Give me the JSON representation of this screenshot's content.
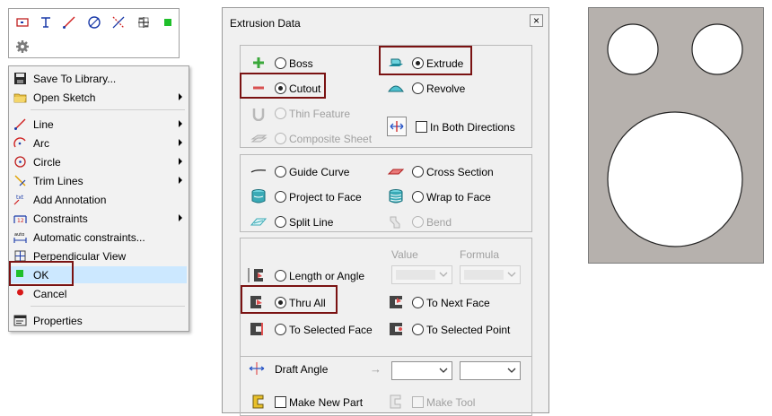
{
  "toolbar": {
    "buttons": [
      "rectangle-icon",
      "text-icon",
      "line-icon",
      "circle-icon",
      "trim-icon",
      "grid-icon",
      "ok-green-icon",
      "gear-icon"
    ]
  },
  "context_menu": {
    "items": [
      {
        "label": "Save To Library...",
        "icon": "save-icon",
        "submenu": false
      },
      {
        "label": "Open Sketch",
        "icon": "folder-icon",
        "submenu": true
      },
      {
        "label": "Line",
        "icon": "line-icon",
        "submenu": true
      },
      {
        "label": "Arc",
        "icon": "arc-icon",
        "submenu": true
      },
      {
        "label": "Circle",
        "icon": "circle-icon",
        "submenu": true
      },
      {
        "label": "Trim Lines",
        "icon": "trim-icon",
        "submenu": true
      },
      {
        "label": "Add Annotation",
        "icon": "annotation-icon",
        "submenu": false
      },
      {
        "label": "Constraints",
        "icon": "constraints-icon",
        "submenu": true
      },
      {
        "label": "Automatic constraints...",
        "icon": "auto-constraints-icon",
        "submenu": false
      },
      {
        "label": "Perpendicular View",
        "icon": "perpendicular-icon",
        "submenu": false
      },
      {
        "label": "OK",
        "icon": "ok-icon",
        "submenu": false
      },
      {
        "label": "Cancel",
        "icon": "cancel-icon",
        "submenu": false
      },
      {
        "label": "Properties",
        "icon": "properties-icon",
        "submenu": false
      }
    ],
    "highlighted": "OK"
  },
  "dialog": {
    "title": "Extrusion Data",
    "close_glyph": "×",
    "type_section": {
      "boss": {
        "label": "Boss",
        "selected": false
      },
      "cutout": {
        "label": "Cutout",
        "selected": true
      },
      "thin_feature": {
        "label": "Thin Feature",
        "enabled": false
      },
      "composite_sheet": {
        "label": "Composite Sheet",
        "enabled": false
      },
      "extrude": {
        "label": "Extrude",
        "selected": true
      },
      "revolve": {
        "label": "Revolve",
        "selected": false
      },
      "both_directions": {
        "label": "In Both Directions",
        "checked": false
      }
    },
    "path_section": {
      "guide_curve": {
        "label": "Guide Curve"
      },
      "project_to_face": {
        "label": "Project to Face"
      },
      "split_line": {
        "label": "Split Line"
      },
      "cross_section": {
        "label": "Cross Section"
      },
      "wrap_to_face": {
        "label": "Wrap to Face"
      },
      "bend": {
        "label": "Bend",
        "enabled": false
      }
    },
    "extent_section": {
      "value_header": "Value",
      "formula_header": "Formula",
      "length_or_angle": {
        "label": "Length or Angle",
        "selected": false
      },
      "thru_all": {
        "label": "Thru All",
        "selected": true
      },
      "to_selected_face": {
        "label": "To Selected Face",
        "selected": false
      },
      "to_next_face": {
        "label": "To Next Face",
        "selected": false
      },
      "to_selected_point": {
        "label": "To Selected Point",
        "selected": false
      }
    },
    "draft_angle": {
      "label": "Draft Angle",
      "arrow": "→"
    },
    "make_new_part": {
      "label": "Make New Part",
      "checked": false
    },
    "make_tool": {
      "label": "Make Tool",
      "enabled": false
    }
  },
  "colors": {
    "highlight": "#cce8ff",
    "annotation_box": "#7a1212",
    "preview_fill": "#b6b1ad",
    "ok_green": "#1fbf2a"
  }
}
